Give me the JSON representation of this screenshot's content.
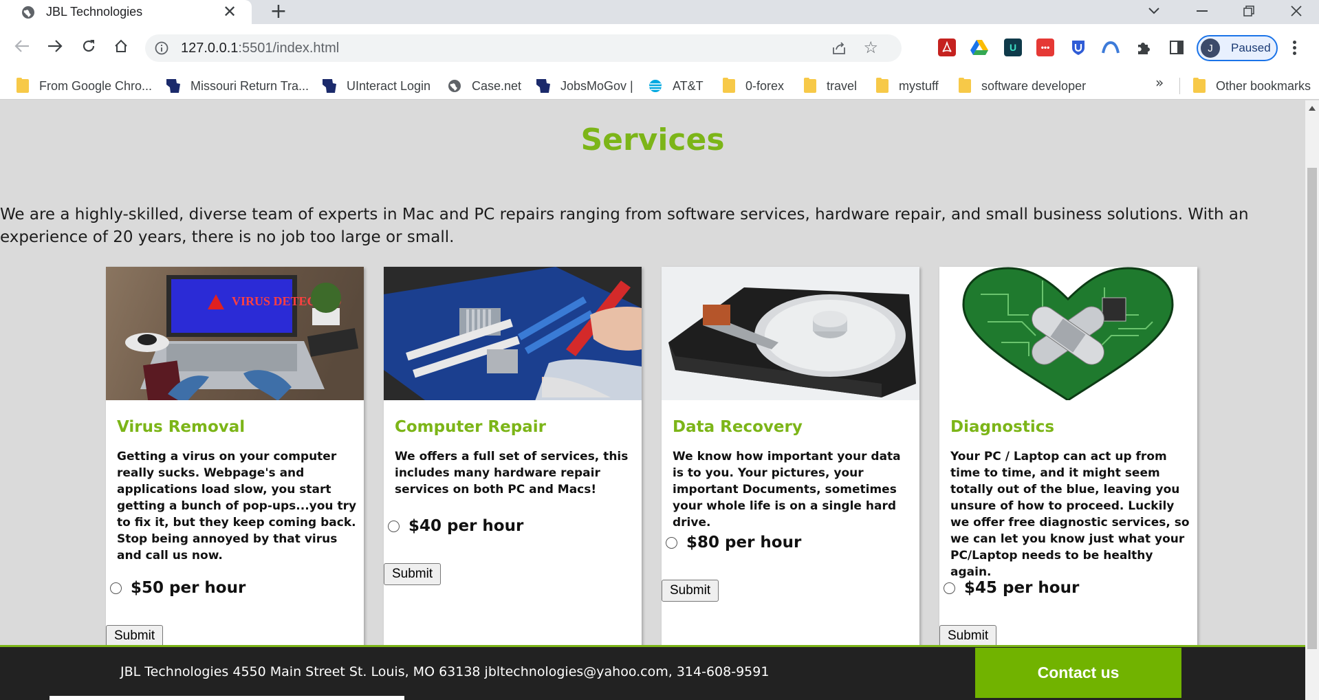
{
  "browser": {
    "tab_title": "JBL Technologies",
    "tab_close": "✕",
    "new_tab": "+",
    "url_host": "127.0.0.1",
    "url_rest": ":5501/index.html",
    "profile_initial": "J",
    "profile_status": "Paused",
    "extensions": [
      {
        "name": "pdf-extension-icon",
        "color": "#c5221f",
        "glyph": "A"
      },
      {
        "name": "drive-extension-icon",
        "color": "#ffffff",
        "glyph": ""
      },
      {
        "name": "u-extension-icon",
        "color": "#0f3a4a",
        "glyph": "U"
      },
      {
        "name": "dots-extension-icon",
        "color": "#e53935",
        "glyph": "•••"
      },
      {
        "name": "shield-u-extension-icon",
        "color": "#ffffff",
        "glyph": "U"
      },
      {
        "name": "arch-extension-icon",
        "color": "#ffffff",
        "glyph": "∩"
      }
    ]
  },
  "bookmarks": {
    "items": [
      {
        "label": "From Google Chro...",
        "icon": "folder"
      },
      {
        "label": "Missouri Return Tra...",
        "icon": "missouri"
      },
      {
        "label": "UInteract Login",
        "icon": "missouri"
      },
      {
        "label": "Case.net",
        "icon": "globe"
      },
      {
        "label": "JobsMoGov |",
        "icon": "missouri"
      },
      {
        "label": "AT&T",
        "icon": "att"
      },
      {
        "label": "0-forex",
        "icon": "folder"
      },
      {
        "label": "travel",
        "icon": "folder"
      },
      {
        "label": "mystuff",
        "icon": "folder"
      },
      {
        "label": "software developer",
        "icon": "folder"
      }
    ],
    "overflow": "»",
    "other": "Other bookmarks"
  },
  "page": {
    "heading": "Services",
    "intro": "We are a highly-skilled, diverse team of experts in Mac and PC repairs ranging from software services, hardware repair, and small business solutions. With an experience of 20 years, there is no job too large or small.",
    "cards": [
      {
        "title": "Virus Removal",
        "description": "Getting a virus on your computer really sucks. Webpage's and applications load slow, you start getting a bunch of pop-ups...you try to fix it, but they keep coming back. Stop being annoyed by that virus and call us now.",
        "price": "$50 per hour",
        "submit": "Submit",
        "image": "laptop-virus-detected-image",
        "image_text": "VIRUS DETECTED"
      },
      {
        "title": "Computer Repair",
        "description": "We offers a full set of services, this includes many hardware repair services on both PC and Macs!",
        "price": "$40 per hour",
        "submit": "Submit",
        "image": "motherboard-repair-image"
      },
      {
        "title": "Data Recovery",
        "description": "We know how important your data is to you. Your pictures, your important Documents, sometimes your whole life is on a single hard drive.",
        "price": "$80 per hour",
        "submit": "Submit",
        "image": "hard-drive-image"
      },
      {
        "title": "Diagnostics",
        "description": "Your PC / Laptop can act up from time to time, and it might seem totally out of the blue, leaving you unsure of how to proceed. Luckily we offer free diagnostic services, so we can let you know just what your PC/Laptop needs to be healthy again.",
        "price": "$45 per hour",
        "submit": "Submit",
        "image": "circuit-heart-bandage-image"
      }
    ]
  },
  "footer": {
    "address": "JBL Technologies 4550 Main Street St. Louis, MO 63138 jbltechnologies@yahoo.com, 314-608-9591",
    "contact": "Contact us"
  },
  "colors": {
    "accent": "#7cb518",
    "contact_bg": "#71b300",
    "footer_bg": "#222222",
    "page_bg": "#dadada"
  }
}
